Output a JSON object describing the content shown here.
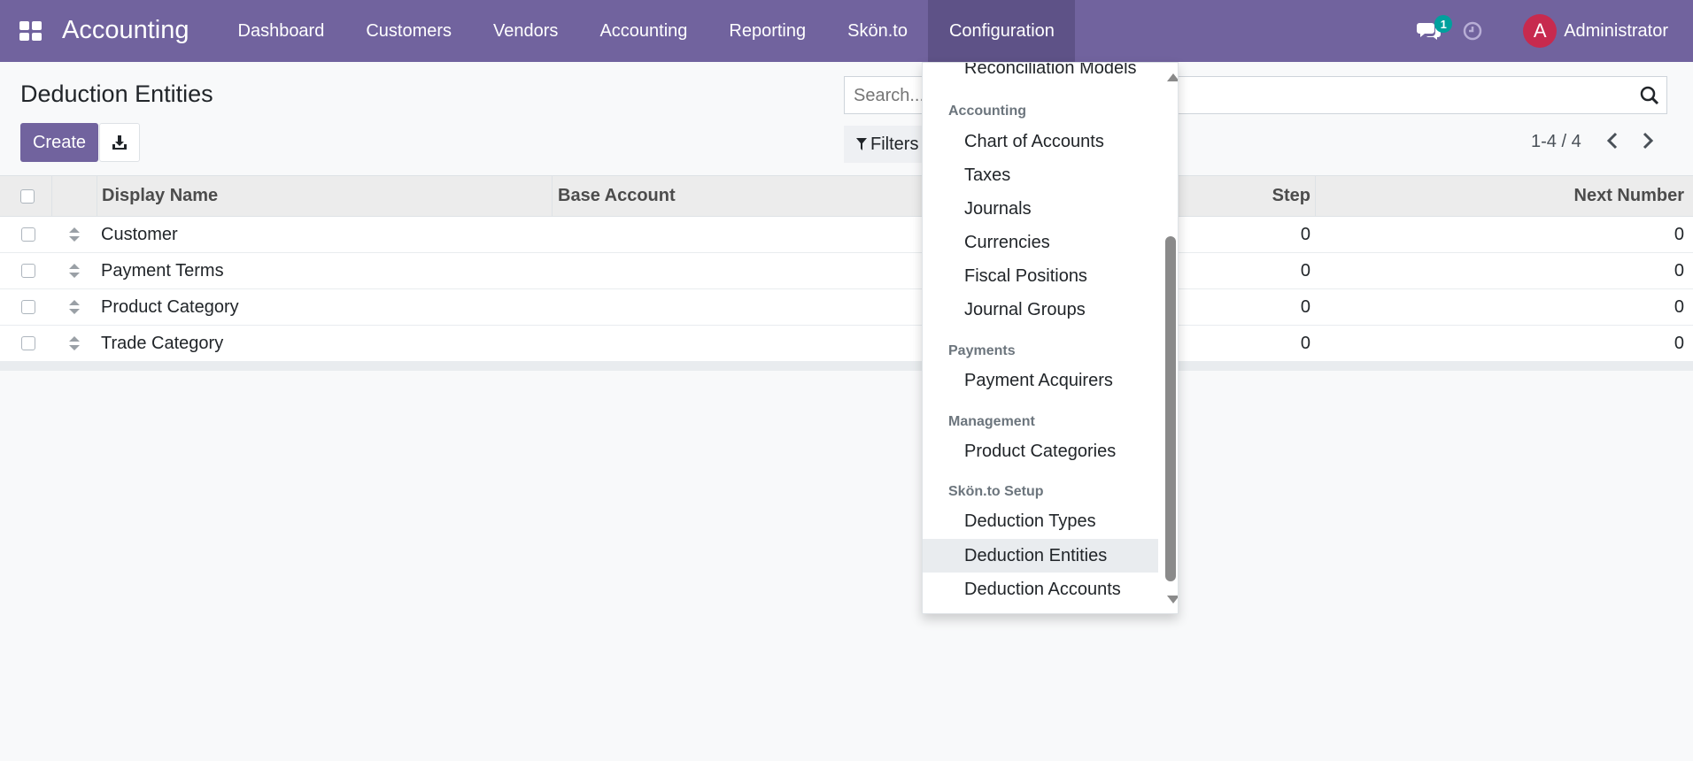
{
  "navbar": {
    "app_title": "Accounting",
    "menu": [
      "Dashboard",
      "Customers",
      "Vendors",
      "Accounting",
      "Reporting",
      "Skön.to",
      "Configuration"
    ],
    "active_menu": "Configuration",
    "chat_badge": "1",
    "avatar_letter": "A",
    "user_name": "Administrator",
    "icons": {
      "apps": "apps-grid-icon",
      "chat": "chat-bubbles-icon",
      "activity": "clock-icon"
    }
  },
  "control_panel": {
    "page_title": "Deduction Entities",
    "create_label": "Create",
    "export_icon": "download-icon",
    "search_placeholder": "Search...",
    "filters_label": "Filters",
    "pager_value": "1-4 / 4"
  },
  "table": {
    "columns": {
      "display_name": "Display Name",
      "base_account": "Base Account",
      "step": "Step",
      "next_number": "Next Number"
    },
    "rows": [
      {
        "display_name": "Customer",
        "base_account": "",
        "step": "0",
        "next_number": "0"
      },
      {
        "display_name": "Payment Terms",
        "base_account": "",
        "step": "0",
        "next_number": "0"
      },
      {
        "display_name": "Product Category",
        "base_account": "",
        "step": "0",
        "next_number": "0"
      },
      {
        "display_name": "Trade Category",
        "base_account": "",
        "step": "0",
        "next_number": "0"
      }
    ]
  },
  "dropdown": {
    "top_item": "Reconciliation Models",
    "sections": [
      {
        "header": "Accounting",
        "items": [
          "Chart of Accounts",
          "Taxes",
          "Journals",
          "Currencies",
          "Fiscal Positions",
          "Journal Groups"
        ]
      },
      {
        "header": "Payments",
        "items": [
          "Payment Acquirers"
        ]
      },
      {
        "header": "Management",
        "items": [
          "Product Categories"
        ]
      },
      {
        "header": "Skön.to Setup",
        "items": [
          "Deduction Types",
          "Deduction Entities",
          "Deduction Accounts"
        ]
      }
    ],
    "highlighted": "Deduction Entities"
  },
  "colors": {
    "brand": "#71639e",
    "avatar": "#c72a4e",
    "badge": "#00a09d"
  }
}
